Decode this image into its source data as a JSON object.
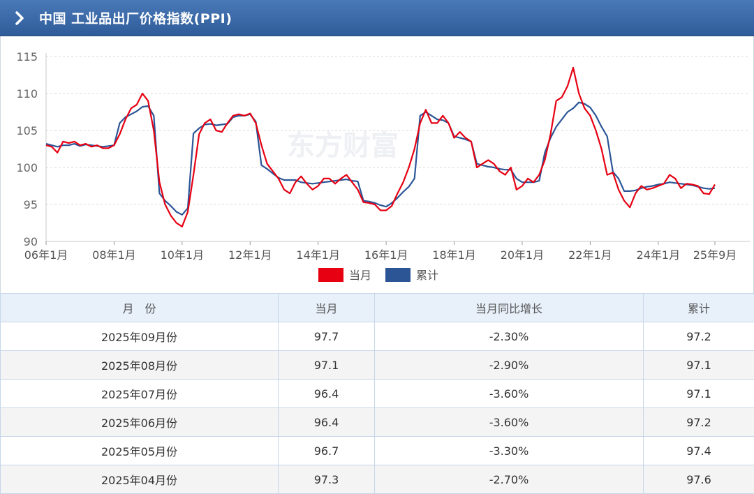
{
  "header": {
    "title": "中国 工业品出厂价格指数(PPI)"
  },
  "chart_data": {
    "type": "line",
    "y_ticks": [
      "115",
      "110",
      "105",
      "100",
      "95",
      "90"
    ],
    "ylim": [
      90,
      115
    ],
    "x_tick_labels": [
      "06年1月",
      "08年1月",
      "10年1月",
      "12年1月",
      "14年1月",
      "16年1月",
      "18年1月",
      "20年1月",
      "22年1月",
      "24年1月",
      "25年9月"
    ],
    "x_tick_months": [
      0,
      24,
      48,
      72,
      96,
      120,
      144,
      168,
      192,
      216,
      236
    ],
    "grid": "horizontal-dashed",
    "legend_position": "bottom-center",
    "series": [
      {
        "name": "当月",
        "color": "#e60012",
        "points": [
          [
            0,
            103
          ],
          [
            2,
            102.8
          ],
          [
            4,
            102
          ],
          [
            6,
            103.5
          ],
          [
            8,
            103.3
          ],
          [
            10,
            103.5
          ],
          [
            12,
            103
          ],
          [
            14,
            103.2
          ],
          [
            16,
            102.8
          ],
          [
            18,
            103
          ],
          [
            20,
            102.6
          ],
          [
            22,
            102.6
          ],
          [
            24,
            103
          ],
          [
            26,
            104.5
          ],
          [
            28,
            106.5
          ],
          [
            30,
            108
          ],
          [
            32,
            108.5
          ],
          [
            34,
            110
          ],
          [
            36,
            109
          ],
          [
            38,
            105
          ],
          [
            40,
            98
          ],
          [
            42,
            95
          ],
          [
            44,
            93.5
          ],
          [
            46,
            92.5
          ],
          [
            48,
            92
          ],
          [
            50,
            94
          ],
          [
            52,
            99
          ],
          [
            54,
            104.5
          ],
          [
            56,
            106
          ],
          [
            58,
            106.5
          ],
          [
            60,
            105
          ],
          [
            62,
            104.8
          ],
          [
            64,
            106
          ],
          [
            66,
            107
          ],
          [
            68,
            107.2
          ],
          [
            70,
            107
          ],
          [
            72,
            107.3
          ],
          [
            74,
            106
          ],
          [
            76,
            103
          ],
          [
            78,
            100.5
          ],
          [
            80,
            99.5
          ],
          [
            82,
            98.5
          ],
          [
            84,
            97
          ],
          [
            86,
            96.5
          ],
          [
            88,
            98
          ],
          [
            90,
            98.8
          ],
          [
            92,
            97.8
          ],
          [
            94,
            97
          ],
          [
            96,
            97.5
          ],
          [
            98,
            98.5
          ],
          [
            100,
            98.5
          ],
          [
            102,
            97.8
          ],
          [
            104,
            98.5
          ],
          [
            106,
            99
          ],
          [
            108,
            98
          ],
          [
            110,
            97
          ],
          [
            112,
            95.3
          ],
          [
            114,
            95.2
          ],
          [
            116,
            95
          ],
          [
            118,
            94.2
          ],
          [
            120,
            94.2
          ],
          [
            122,
            94.8
          ],
          [
            124,
            96.5
          ],
          [
            126,
            98
          ],
          [
            128,
            100
          ],
          [
            130,
            102.5
          ],
          [
            132,
            106
          ],
          [
            134,
            107.8
          ],
          [
            136,
            106
          ],
          [
            138,
            106
          ],
          [
            140,
            107
          ],
          [
            142,
            106
          ],
          [
            144,
            104
          ],
          [
            146,
            104.8
          ],
          [
            148,
            104
          ],
          [
            150,
            103.5
          ],
          [
            152,
            100
          ],
          [
            154,
            100.5
          ],
          [
            156,
            101
          ],
          [
            158,
            100.5
          ],
          [
            160,
            99.5
          ],
          [
            162,
            99
          ],
          [
            164,
            100
          ],
          [
            166,
            97
          ],
          [
            168,
            97.5
          ],
          [
            170,
            98.5
          ],
          [
            172,
            98
          ],
          [
            174,
            99
          ],
          [
            176,
            101
          ],
          [
            178,
            104.5
          ],
          [
            180,
            109
          ],
          [
            182,
            109.5
          ],
          [
            184,
            111
          ],
          [
            186,
            113.5
          ],
          [
            188,
            110
          ],
          [
            190,
            108
          ],
          [
            192,
            107
          ],
          [
            194,
            105
          ],
          [
            196,
            102.5
          ],
          [
            198,
            99
          ],
          [
            200,
            99.3
          ],
          [
            202,
            97
          ],
          [
            204,
            95.5
          ],
          [
            206,
            94.6
          ],
          [
            208,
            96.5
          ],
          [
            210,
            97.5
          ],
          [
            212,
            97
          ],
          [
            214,
            97.2
          ],
          [
            216,
            97.5
          ],
          [
            218,
            97.8
          ],
          [
            220,
            99
          ],
          [
            222,
            98.5
          ],
          [
            224,
            97.2
          ],
          [
            226,
            97.8
          ],
          [
            228,
            97.7
          ],
          [
            230,
            97.5
          ],
          [
            232,
            96.5
          ],
          [
            234,
            96.4
          ],
          [
            236,
            97.7
          ]
        ]
      },
      {
        "name": "累计",
        "color": "#2c5596",
        "points": [
          [
            0,
            103.2
          ],
          [
            2,
            103
          ],
          [
            4,
            102.8
          ],
          [
            6,
            103
          ],
          [
            8,
            103
          ],
          [
            10,
            103.2
          ],
          [
            12,
            102.9
          ],
          [
            14,
            103.1
          ],
          [
            16,
            103
          ],
          [
            18,
            102.9
          ],
          [
            20,
            102.8
          ],
          [
            22,
            102.9
          ],
          [
            24,
            103
          ],
          [
            26,
            106
          ],
          [
            28,
            106.8
          ],
          [
            30,
            107.2
          ],
          [
            32,
            107.6
          ],
          [
            34,
            108.2
          ],
          [
            36,
            108.3
          ],
          [
            38,
            107
          ],
          [
            40,
            96.5
          ],
          [
            42,
            95.5
          ],
          [
            44,
            94.8
          ],
          [
            46,
            94
          ],
          [
            48,
            93.6
          ],
          [
            50,
            94.5
          ],
          [
            52,
            104.6
          ],
          [
            54,
            105.3
          ],
          [
            56,
            105.8
          ],
          [
            58,
            105.9
          ],
          [
            60,
            105.7
          ],
          [
            62,
            105.8
          ],
          [
            64,
            105.9
          ],
          [
            66,
            106.8
          ],
          [
            68,
            107
          ],
          [
            70,
            107
          ],
          [
            72,
            107.2
          ],
          [
            74,
            106.2
          ],
          [
            76,
            100.3
          ],
          [
            78,
            99.8
          ],
          [
            80,
            99.2
          ],
          [
            82,
            98.6
          ],
          [
            84,
            98.3
          ],
          [
            86,
            98.3
          ],
          [
            88,
            98.3
          ],
          [
            90,
            98
          ],
          [
            92,
            97.9
          ],
          [
            94,
            97.8
          ],
          [
            96,
            97.9
          ],
          [
            98,
            98
          ],
          [
            100,
            98.1
          ],
          [
            102,
            98.2
          ],
          [
            104,
            98.3
          ],
          [
            106,
            98.4
          ],
          [
            108,
            98.2
          ],
          [
            110,
            98.1
          ],
          [
            112,
            95.5
          ],
          [
            114,
            95.4
          ],
          [
            116,
            95.2
          ],
          [
            118,
            94.9
          ],
          [
            120,
            94.7
          ],
          [
            122,
            95.2
          ],
          [
            124,
            95.9
          ],
          [
            126,
            96.7
          ],
          [
            128,
            97.4
          ],
          [
            130,
            98.5
          ],
          [
            132,
            107
          ],
          [
            134,
            107.5
          ],
          [
            136,
            107
          ],
          [
            138,
            106.5
          ],
          [
            140,
            106.4
          ],
          [
            142,
            106
          ],
          [
            144,
            104.2
          ],
          [
            146,
            104
          ],
          [
            148,
            103.8
          ],
          [
            150,
            103.5
          ],
          [
            152,
            100.5
          ],
          [
            154,
            100.3
          ],
          [
            156,
            100.1
          ],
          [
            158,
            100
          ],
          [
            160,
            99.8
          ],
          [
            162,
            99.7
          ],
          [
            164,
            99.7
          ],
          [
            166,
            98.5
          ],
          [
            168,
            98
          ],
          [
            170,
            98
          ],
          [
            172,
            98
          ],
          [
            174,
            98.2
          ],
          [
            176,
            102
          ],
          [
            178,
            104
          ],
          [
            180,
            105.5
          ],
          [
            182,
            106.5
          ],
          [
            184,
            107.5
          ],
          [
            186,
            108
          ],
          [
            188,
            108.8
          ],
          [
            190,
            108.6
          ],
          [
            192,
            108.1
          ],
          [
            194,
            107
          ],
          [
            196,
            105.5
          ],
          [
            198,
            104.2
          ],
          [
            200,
            99.4
          ],
          [
            202,
            98.5
          ],
          [
            204,
            96.8
          ],
          [
            206,
            96.8
          ],
          [
            208,
            96.9
          ],
          [
            210,
            97.2
          ],
          [
            212,
            97.4
          ],
          [
            214,
            97.5
          ],
          [
            216,
            97.7
          ],
          [
            218,
            97.8
          ],
          [
            220,
            98
          ],
          [
            222,
            97.9
          ],
          [
            224,
            97.8
          ],
          [
            226,
            97.7
          ],
          [
            228,
            97.6
          ],
          [
            230,
            97.4
          ],
          [
            232,
            97.2
          ],
          [
            234,
            97.1
          ],
          [
            236,
            97.2
          ]
        ]
      }
    ]
  },
  "watermark": {
    "text": "东方财富"
  },
  "table": {
    "columns": [
      "月　份",
      "当月",
      "当月同比增长",
      "累计"
    ],
    "rows": [
      {
        "month": "2025年09月份",
        "current": "97.7",
        "yoy": "-2.30%",
        "cumulative": "97.2"
      },
      {
        "month": "2025年08月份",
        "current": "97.1",
        "yoy": "-2.90%",
        "cumulative": "97.1"
      },
      {
        "month": "2025年07月份",
        "current": "96.4",
        "yoy": "-3.60%",
        "cumulative": "97.1"
      },
      {
        "month": "2025年06月份",
        "current": "96.4",
        "yoy": "-3.60%",
        "cumulative": "97.2"
      },
      {
        "month": "2025年05月份",
        "current": "96.7",
        "yoy": "-3.30%",
        "cumulative": "97.4"
      },
      {
        "month": "2025年04月份",
        "current": "97.3",
        "yoy": "-2.70%",
        "cumulative": "97.6"
      }
    ],
    "negative_color": "#2e9e33"
  }
}
